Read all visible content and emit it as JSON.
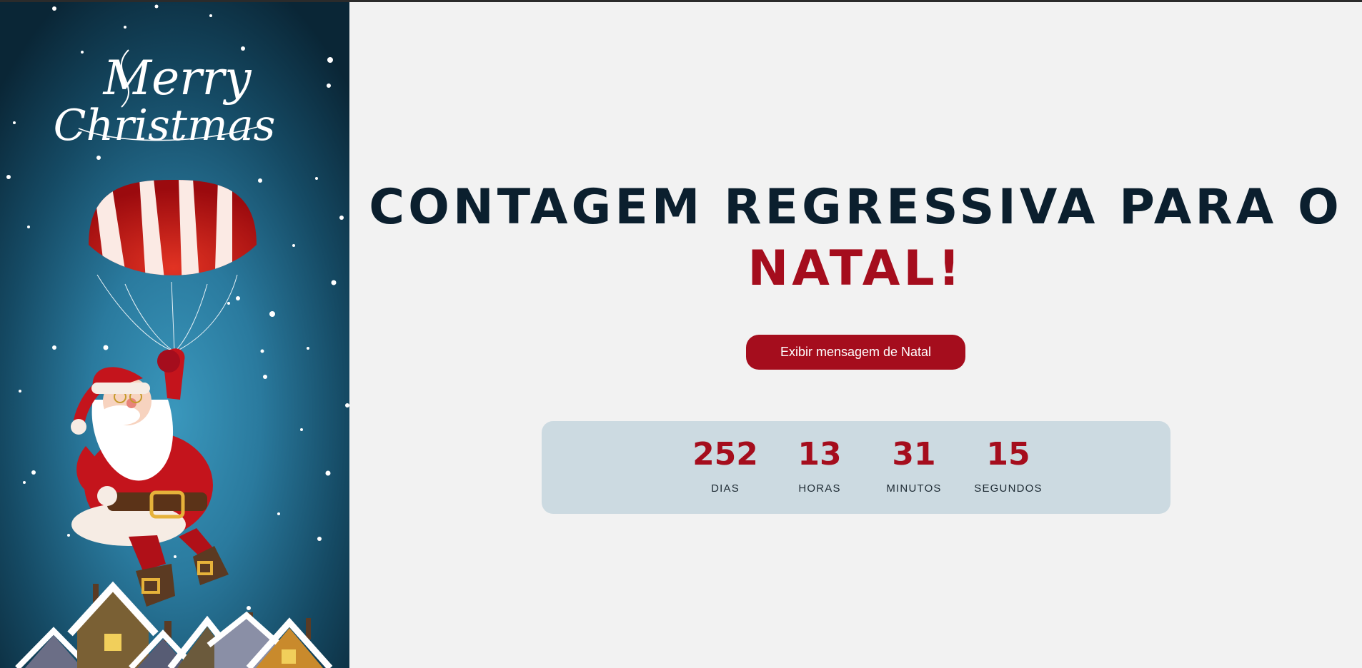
{
  "sidebar": {
    "greeting_line1": "Merry",
    "greeting_line2": "Christmas"
  },
  "hero": {
    "title_main": "CONTAGEM REGRESSIVA PARA O",
    "title_accent": "NATAL!"
  },
  "cta": {
    "label": "Exibir mensagem de Natal"
  },
  "countdown": {
    "units": [
      {
        "value": "252",
        "label": "DIAS"
      },
      {
        "value": "13",
        "label": "HORAS"
      },
      {
        "value": "31",
        "label": "MINUTOS"
      },
      {
        "value": "15",
        "label": "SEGUNDOS"
      }
    ]
  },
  "colors": {
    "accent": "#a50d1d",
    "heading": "#0b1f2e",
    "panel": "#ccdae1",
    "background": "#f2f2f2",
    "sidebar_blue": "#2a7a9e"
  }
}
